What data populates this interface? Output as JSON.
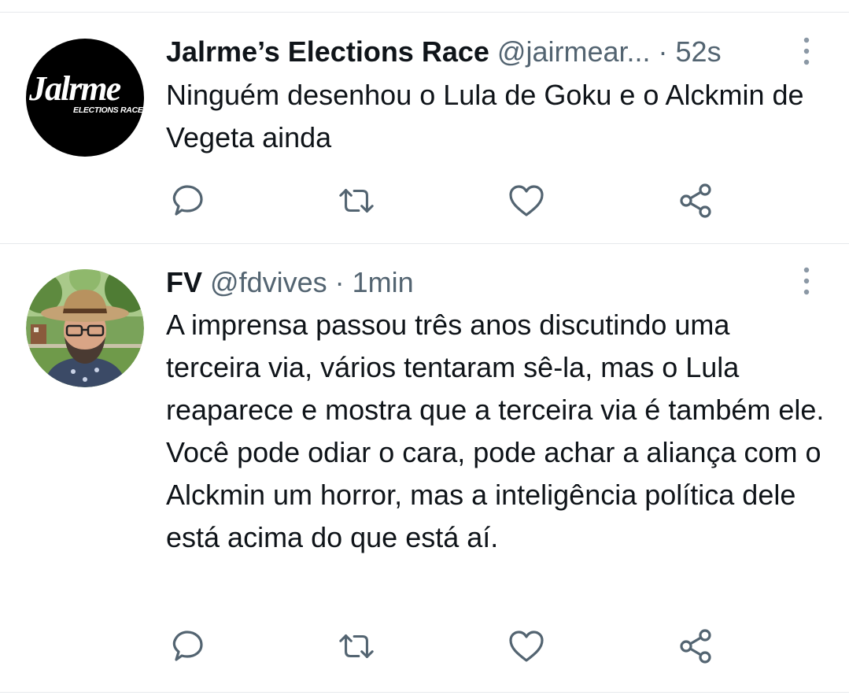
{
  "tweets": [
    {
      "name": "Jalrme’s Elections Race",
      "handle": "@jairmear...",
      "separator": "·",
      "time": "52s",
      "text": "Ninguém desenhou o Lula de Goku e o Alckmin de Vegeta ainda",
      "avatar_logo_text": "Jalrme",
      "avatar_logo_subtext": "ELECTIONS RACE"
    },
    {
      "name": "FV",
      "handle": "@fdvives",
      "separator": "·",
      "time": "1min",
      "text": "A imprensa passou três anos discutindo uma terceira via, vários tentaram sê-la, mas o Lula reaparece e mostra que a terceira via é também ele. Você pode odiar o cara, pode achar a aliança com o Alckmin um horror, mas a inteligência política dele está acima do que está aí."
    }
  ],
  "icons": {
    "more": "more-vertical-icon",
    "reply": "reply-icon",
    "retweet": "retweet-icon",
    "like": "like-icon",
    "share": "share-icon"
  },
  "colors": {
    "text": "#0f1419",
    "secondary": "#536471",
    "icon": "#536471",
    "divider": "#e6e9ec",
    "avatar_bg": "#000000"
  }
}
